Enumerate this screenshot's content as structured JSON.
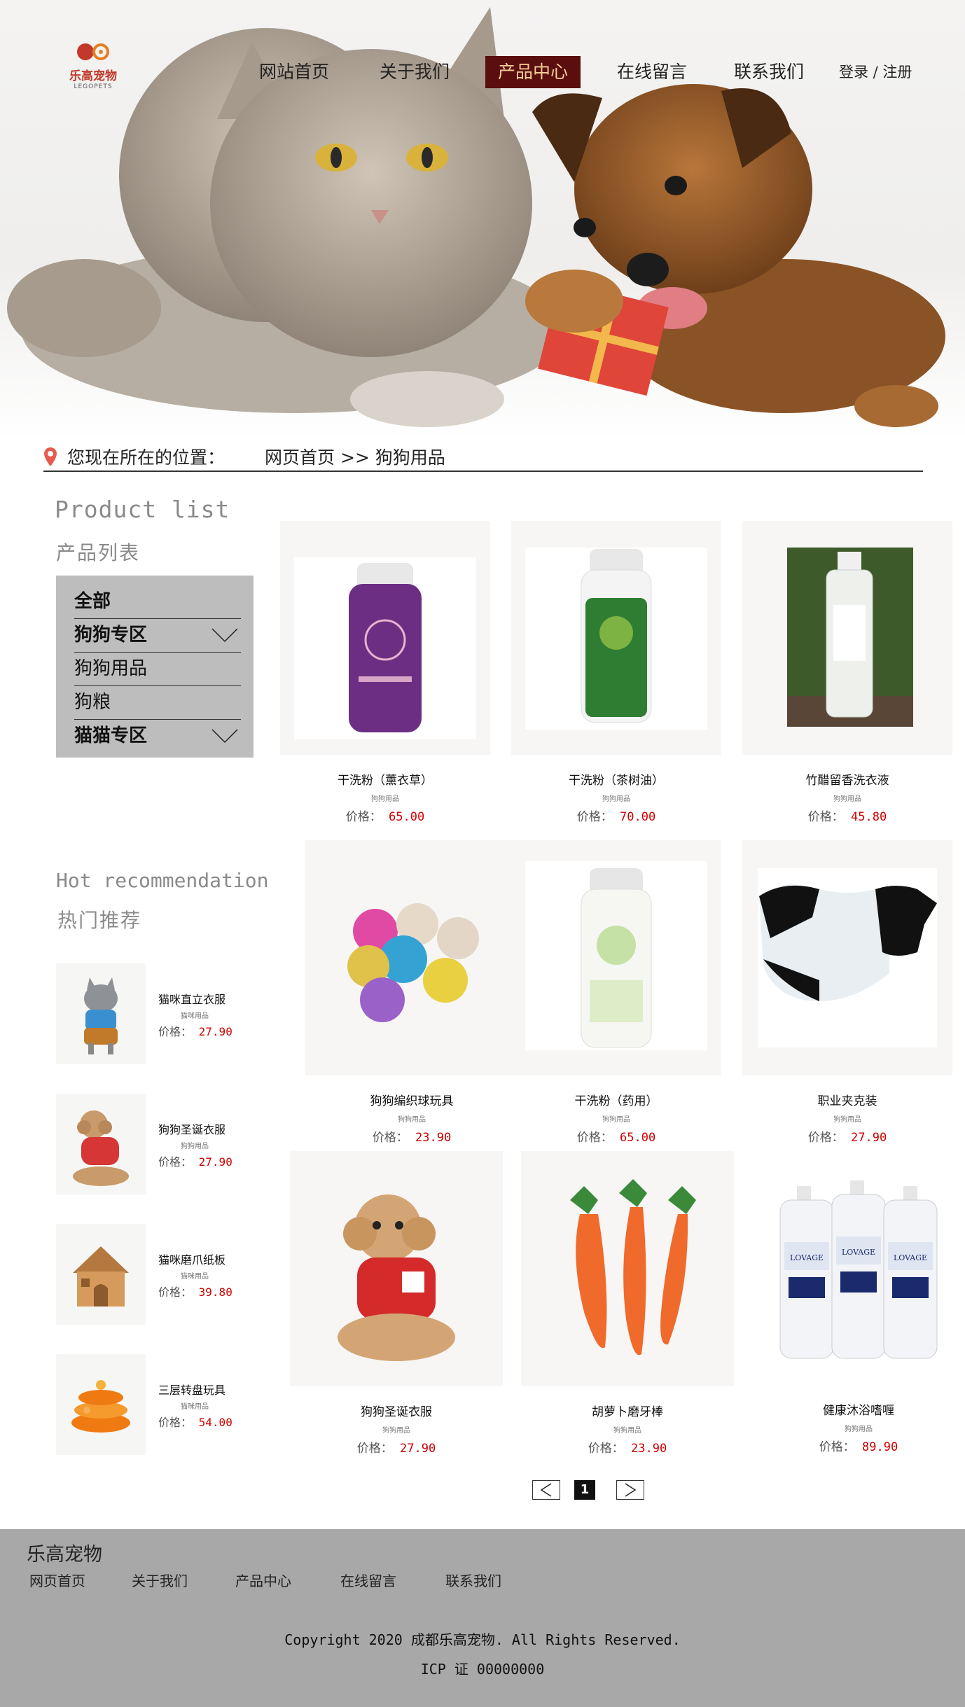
{
  "logo": {
    "name": "乐高宠物",
    "sub": "LEGOPETS"
  },
  "nav": {
    "items": [
      {
        "label": "网站首页"
      },
      {
        "label": "关于我们"
      },
      {
        "label": "产品中心",
        "active": true
      },
      {
        "label": "在线留言"
      },
      {
        "label": "联系我们"
      }
    ],
    "login": "登录 / 注册"
  },
  "breadcrumb": {
    "label": "您现在所在的位置：",
    "path": "网页首页 >> 狗狗用品"
  },
  "sidebar": {
    "title_en": "Product list",
    "title_cn": "产品列表",
    "categories": [
      {
        "label": "全部"
      },
      {
        "label": "狗狗专区"
      },
      {
        "label": "狗狗用品"
      },
      {
        "label": "狗粮"
      },
      {
        "label": "猫猫专区"
      }
    ],
    "hot_title_en": "Hot recommendation",
    "hot_title_cn": "热门推荐",
    "hot_items": [
      {
        "name": "猫咪直立衣服",
        "category": "猫咪用品",
        "price_label": "价格：",
        "price": "27.90"
      },
      {
        "name": "狗狗圣诞衣服",
        "category": "狗狗用品",
        "price_label": "价格：",
        "price": "27.90"
      },
      {
        "name": "猫咪磨爪纸板",
        "category": "猫咪用品",
        "price_label": "价格：",
        "price": "39.80"
      },
      {
        "name": "三层转盘玩具",
        "category": "猫咪用品",
        "price_label": "价格：",
        "price": "54.00"
      }
    ]
  },
  "products": [
    {
      "name": "干洗粉（薰衣草）",
      "category": "狗狗用品",
      "price_label": "价格：",
      "price": "65.00"
    },
    {
      "name": "干洗粉（茶树油）",
      "category": "狗狗用品",
      "price_label": "价格：",
      "price": "70.00"
    },
    {
      "name": "竹醋留香洗衣液",
      "category": "狗狗用品",
      "price_label": "价格：",
      "price": "45.80"
    },
    {
      "name": "狗狗编织球玩具",
      "category": "狗狗用品",
      "price_label": "价格：",
      "price": "23.90"
    },
    {
      "name": "干洗粉（药用）",
      "category": "狗狗用品",
      "price_label": "价格：",
      "price": "65.00"
    },
    {
      "name": "职业夹克装",
      "category": "狗狗用品",
      "price_label": "价格：",
      "price": "27.90"
    },
    {
      "name": "狗狗圣诞衣服",
      "category": "狗狗用品",
      "price_label": "价格：",
      "price": "27.90"
    },
    {
      "name": "胡萝卜磨牙棒",
      "category": "狗狗用品",
      "price_label": "价格：",
      "price": "23.90"
    },
    {
      "name": "健康沐浴嗜喱",
      "category": "狗狗用品",
      "price_label": "价格：",
      "price": "89.90"
    }
  ],
  "product_image_text": {
    "lovage": "LOVAGE"
  },
  "pagination": {
    "current": "1"
  },
  "footer": {
    "brand": "乐高宠物",
    "nav": [
      {
        "label": "网页首页"
      },
      {
        "label": "关于我们"
      },
      {
        "label": "产品中心"
      },
      {
        "label": "在线留言"
      },
      {
        "label": "联系我们"
      }
    ],
    "copyright": "Copyright 2020 成都乐高宠物. All Rights Reserved.",
    "icp": "ICP 证 00000000"
  },
  "colors": {
    "price": "#cc0000",
    "nav_active_bg": "#5b0e0e",
    "nav_active_text": "#f3cf9a",
    "footer_bg": "#a8a8a8",
    "category_box": "#bdbdbd"
  }
}
